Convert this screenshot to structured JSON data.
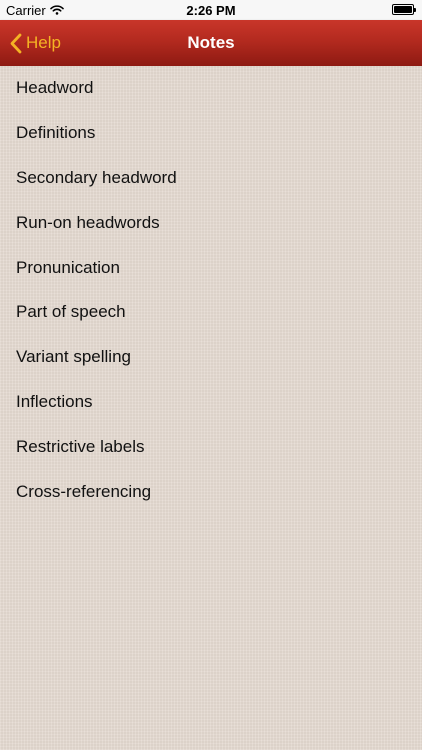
{
  "status_bar": {
    "carrier": "Carrier",
    "time": "2:26 PM"
  },
  "nav": {
    "back_label": "Help",
    "title": "Notes",
    "accent": "#f4b324",
    "bar_color": "#b32a1f"
  },
  "list": {
    "items": [
      {
        "label": "Headword"
      },
      {
        "label": "Definitions"
      },
      {
        "label": "Secondary headword"
      },
      {
        "label": "Run-on headwords"
      },
      {
        "label": "Pronunication"
      },
      {
        "label": "Part of speech"
      },
      {
        "label": "Variant spelling"
      },
      {
        "label": "Inflections"
      },
      {
        "label": "Restrictive labels"
      },
      {
        "label": "Cross-referencing"
      }
    ]
  }
}
